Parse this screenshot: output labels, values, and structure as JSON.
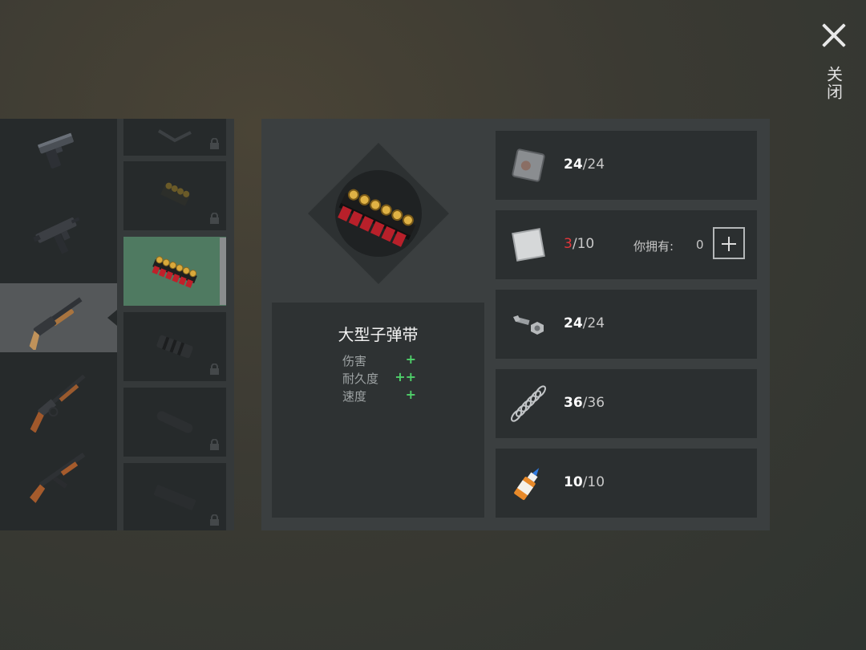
{
  "close": {
    "label": "关闭",
    "icon": "close-icon"
  },
  "weapons": [
    {
      "name": "pistol",
      "selected": false
    },
    {
      "name": "uzi",
      "selected": false
    },
    {
      "name": "shotgun",
      "selected": true
    },
    {
      "name": "lever-rifle",
      "selected": false
    },
    {
      "name": "ak",
      "selected": false
    }
  ],
  "mods": [
    {
      "name": "bipod",
      "locked": true
    },
    {
      "name": "small-shell-holder",
      "locked": true
    },
    {
      "name": "large-shell-holder",
      "locked": false,
      "selected": true
    },
    {
      "name": "muzzle-brake",
      "locked": true
    },
    {
      "name": "silencer",
      "locked": true
    },
    {
      "name": "magazine",
      "locked": true
    }
  ],
  "item": {
    "name": "大型子弹带",
    "stats": [
      {
        "label": "伤害",
        "value": "+"
      },
      {
        "label": "耐久度",
        "value": "++"
      },
      {
        "label": "速度",
        "value": "+"
      }
    ]
  },
  "materials": [
    {
      "icon": "metal-plate-icon",
      "have": "24",
      "sep": "/",
      "need": "24",
      "low": false
    },
    {
      "icon": "aluminum-plate-icon",
      "have": "3",
      "sep": "/",
      "need": "10",
      "low": true,
      "own_label": "你拥有:",
      "own_value": "0"
    },
    {
      "icon": "nuts-bolts-icon",
      "have": "24",
      "sep": "/",
      "need": "24",
      "low": false
    },
    {
      "icon": "spring-icon",
      "have": "36",
      "sep": "/",
      "need": "36",
      "low": false
    },
    {
      "icon": "glue-icon",
      "have": "10",
      "sep": "/",
      "need": "10",
      "low": false
    }
  ],
  "colors": {
    "highlight": "#4f7a61",
    "stat_plus": "#4fd06a",
    "insufficient": "#e0363a"
  }
}
